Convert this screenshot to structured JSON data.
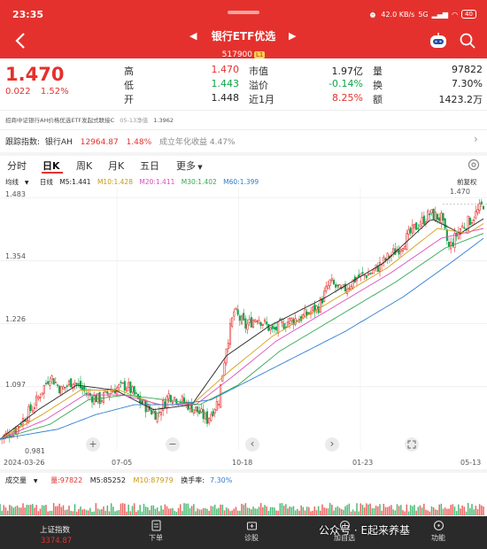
{
  "status_bar": {
    "time": "23:35",
    "speed": "42.0 KB/s",
    "network": "5G",
    "battery": "40"
  },
  "header": {
    "title": "银行ETF优选",
    "code": "517900",
    "code_tag": "L1"
  },
  "quote": {
    "price": "1.470",
    "change": "0.022",
    "change_pct": "1.52%",
    "col1": [
      {
        "label": "高",
        "value": "1.470",
        "tone": "red"
      },
      {
        "label": "低",
        "value": "1.443",
        "tone": "green"
      },
      {
        "label": "开",
        "value": "1.448",
        "tone": "red"
      }
    ],
    "col2": [
      {
        "label": "市值",
        "value": "1.97亿",
        "tone": "dark"
      },
      {
        "label": "溢价",
        "value": "-0.14%",
        "tone": "green"
      },
      {
        "label": "近1月",
        "value": "8.25%",
        "tone": "red"
      }
    ],
    "col3": [
      {
        "label": "量",
        "value": "97822",
        "tone": "dark"
      },
      {
        "label": "换",
        "value": "7.30%",
        "tone": "dark"
      },
      {
        "label": "额",
        "value": "1423.2万",
        "tone": "dark"
      }
    ]
  },
  "fund_line": {
    "text": "招商中证银行AH价格优选ETF发起式联接C",
    "date": "05-13净值",
    "nav": "1.3962"
  },
  "track": {
    "label": "跟踪指数:",
    "index": "银行AH",
    "value": "12964.87",
    "pct": "1.48%",
    "annual": "成立年化收益 4.47%"
  },
  "tabs": [
    "分时",
    "日K",
    "周K",
    "月K",
    "五日",
    "更多"
  ],
  "indicators": {
    "ma_label": "均线",
    "period": "日线",
    "ma5": "M5:1.441",
    "ma10": "M10:1.428",
    "ma20": "M20:1.411",
    "ma30": "M30:1.402",
    "ma60": "M60:1.399",
    "adjust": "前复权"
  },
  "colors": {
    "brand": "#e5312d",
    "down": "#10a34a",
    "ma5": "#222222",
    "ma10": "#d4a017",
    "ma20": "#d94fbf",
    "ma30": "#35a853",
    "ma60": "#2f7fd1"
  },
  "chart_data": {
    "type": "candlestick",
    "y_ticks": [
      "1.483",
      "1.354",
      "1.226",
      "1.097",
      "0.981"
    ],
    "x_ticks": [
      "2024-03-26",
      "07-05",
      "10-18",
      "01-23",
      "05-13"
    ],
    "ylim": [
      0.968,
      1.496
    ],
    "last_price_label": "1.470",
    "min_label": "0.981",
    "close_path": [
      [
        0,
        0.99
      ],
      [
        8,
        1.01
      ],
      [
        18,
        1.06
      ],
      [
        26,
        1.12
      ],
      [
        32,
        1.09
      ],
      [
        38,
        1.11
      ],
      [
        46,
        1.08
      ],
      [
        52,
        1.07
      ],
      [
        58,
        1.09
      ],
      [
        66,
        1.1
      ],
      [
        72,
        1.07
      ],
      [
        78,
        1.05
      ],
      [
        82,
        1.04
      ],
      [
        88,
        1.08
      ],
      [
        94,
        1.07
      ],
      [
        102,
        1.05
      ],
      [
        108,
        1.03
      ],
      [
        114,
        1.07
      ],
      [
        118,
        1.18
      ],
      [
        122,
        1.25
      ],
      [
        128,
        1.22
      ],
      [
        134,
        1.24
      ],
      [
        142,
        1.21
      ],
      [
        150,
        1.23
      ],
      [
        158,
        1.24
      ],
      [
        166,
        1.26
      ],
      [
        172,
        1.31
      ],
      [
        178,
        1.29
      ],
      [
        186,
        1.32
      ],
      [
        194,
        1.33
      ],
      [
        202,
        1.36
      ],
      [
        208,
        1.38
      ],
      [
        216,
        1.42
      ],
      [
        224,
        1.45
      ],
      [
        230,
        1.44
      ],
      [
        234,
        1.38
      ],
      [
        240,
        1.42
      ],
      [
        246,
        1.44
      ],
      [
        252,
        1.47
      ]
    ],
    "ma_series": [
      {
        "name": "M5",
        "values": [
          [
            0,
            0.99
          ],
          [
            20,
            1.05
          ],
          [
            40,
            1.1
          ],
          [
            60,
            1.09
          ],
          [
            80,
            1.05
          ],
          [
            100,
            1.06
          ],
          [
            118,
            1.16
          ],
          [
            140,
            1.22
          ],
          [
            170,
            1.28
          ],
          [
            200,
            1.35
          ],
          [
            225,
            1.44
          ],
          [
            240,
            1.41
          ],
          [
            252,
            1.44
          ]
        ]
      },
      {
        "name": "M10",
        "values": [
          [
            0,
            0.99
          ],
          [
            22,
            1.04
          ],
          [
            42,
            1.09
          ],
          [
            62,
            1.09
          ],
          [
            82,
            1.06
          ],
          [
            100,
            1.06
          ],
          [
            120,
            1.13
          ],
          [
            142,
            1.2
          ],
          [
            172,
            1.27
          ],
          [
            202,
            1.34
          ],
          [
            228,
            1.42
          ],
          [
            244,
            1.41
          ],
          [
            252,
            1.43
          ]
        ]
      },
      {
        "name": "M20",
        "values": [
          [
            0,
            0.99
          ],
          [
            24,
            1.03
          ],
          [
            44,
            1.08
          ],
          [
            64,
            1.08
          ],
          [
            84,
            1.06
          ],
          [
            102,
            1.06
          ],
          [
            122,
            1.12
          ],
          [
            144,
            1.19
          ],
          [
            174,
            1.26
          ],
          [
            204,
            1.33
          ],
          [
            230,
            1.4
          ],
          [
            252,
            1.42
          ]
        ]
      },
      {
        "name": "M30",
        "values": [
          [
            0,
            0.99
          ],
          [
            26,
            1.02
          ],
          [
            46,
            1.07
          ],
          [
            66,
            1.08
          ],
          [
            86,
            1.07
          ],
          [
            104,
            1.06
          ],
          [
            124,
            1.1
          ],
          [
            146,
            1.17
          ],
          [
            176,
            1.24
          ],
          [
            206,
            1.31
          ],
          [
            232,
            1.38
          ],
          [
            252,
            1.41
          ]
        ]
      },
      {
        "name": "M60",
        "values": [
          [
            0,
            0.99
          ],
          [
            30,
            1.01
          ],
          [
            50,
            1.04
          ],
          [
            70,
            1.06
          ],
          [
            90,
            1.06
          ],
          [
            110,
            1.07
          ],
          [
            130,
            1.11
          ],
          [
            150,
            1.15
          ],
          [
            180,
            1.21
          ],
          [
            210,
            1.28
          ],
          [
            235,
            1.35
          ],
          [
            252,
            1.4
          ]
        ]
      }
    ],
    "n_bars": 253
  },
  "chart_controls": {
    "zoom_in": "+",
    "zoom_out": "−",
    "prev": "‹",
    "next": "›"
  },
  "volume": {
    "label": "成交量",
    "vol": "量:97822",
    "m5": "M5:85252",
    "m10": "M10:87979",
    "turnover_label": "换手率:",
    "turnover": "7.30%"
  },
  "bottom_bar": {
    "index_name": "上证指数",
    "index_value": "3374.87",
    "items": [
      "下单",
      "诊股",
      "加自选",
      "功能"
    ]
  },
  "watermark": "公众号 · E起来养基"
}
